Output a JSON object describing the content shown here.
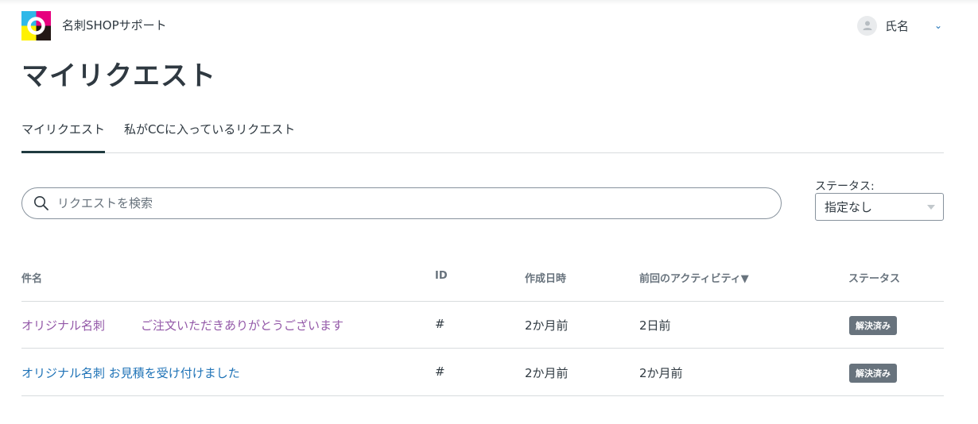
{
  "header": {
    "brand": "名刺SHOPサポート",
    "user_name": "氏名",
    "chevron": "⌄"
  },
  "page_title": "マイリクエスト",
  "tabs": [
    {
      "label": "マイリクエスト",
      "active": true
    },
    {
      "label": "私がCCに入っているリクエスト",
      "active": false
    }
  ],
  "search": {
    "placeholder": "リクエストを検索",
    "value": ""
  },
  "status_filter": {
    "label": "ステータス:",
    "selected": "指定なし"
  },
  "table": {
    "columns": [
      "件名",
      "ID",
      "作成日時",
      "前回のアクティビティ▼",
      "ステータス"
    ],
    "rows": [
      {
        "subject": "オリジナル名刺　　　ご注文いただきありがとうございます",
        "id": "#",
        "created": "2か月前",
        "last_activity": "2日前",
        "status": "解決済み",
        "visited": true
      },
      {
        "subject": "オリジナル名刺 お見積を受け付けました",
        "id": "#",
        "created": "2か月前",
        "last_activity": "2か月前",
        "status": "解決済み",
        "visited": false
      }
    ]
  },
  "colors": {
    "link": "#1f73b7",
    "visited_link": "#9358a8",
    "badge": "#68737d",
    "text": "#2f3941"
  }
}
